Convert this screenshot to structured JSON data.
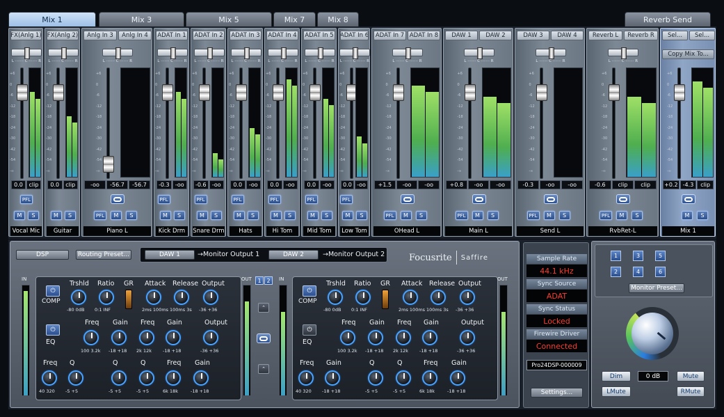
{
  "tabs": [
    "Mix 1",
    "Mix 3",
    "Mix 5",
    "Mix 7",
    "Mix 8",
    "Reverb Send"
  ],
  "active_tab": "Mix 1",
  "channel_headers": [
    "FX(Anlg 1)",
    "FX(Anlg 2)",
    "Anlg In 3",
    "Anlg In 4",
    "ADAT In 1",
    "ADAT In 2",
    "ADAT In 3",
    "ADAT In 4",
    "ADAT In 5",
    "ADAT In 6",
    "ADAT In 7",
    "ADAT In 8",
    "DAW 1",
    "DAW 2",
    "DAW 3",
    "DAW 4",
    "Reverb L",
    "Reverb R",
    "Sel...",
    "Sel..."
  ],
  "copy_mix_label": "Copy Mix To...",
  "pan_scale": "L ······· C ······· R",
  "fader_scale": [
    "+6",
    "0",
    "-6",
    "-12",
    "-18",
    "-24",
    "-30",
    "-42",
    "-54",
    "-∞"
  ],
  "channels": [
    {
      "name": "Vocal Mic",
      "readouts": [
        "0.0",
        "clip"
      ],
      "level": 0.78,
      "pfl": "PFL",
      "link": false
    },
    {
      "name": "Guitar",
      "readouts": [
        "0.0",
        "clip"
      ],
      "level": 0.56,
      "pfl": "PFL",
      "link": false
    },
    {
      "name": "Piano L",
      "readouts": [
        "-oo",
        "-56.7",
        "-56.7"
      ],
      "level": 0.0,
      "pfl": "PFL",
      "link": true
    },
    {
      "name": "Kick Drm",
      "readouts": [
        "-0.3",
        "-oo"
      ],
      "level": 0.78,
      "pfl": "PFL",
      "link": false
    },
    {
      "name": "Snare Drm",
      "readouts": [
        "-0.6",
        "-oo"
      ],
      "level": 0.22,
      "pfl": "PFL",
      "link": false
    },
    {
      "name": "Hats",
      "readouts": [
        "0.0",
        "-oo"
      ],
      "level": 0.45,
      "pfl": "PFL",
      "link": false
    },
    {
      "name": "Hi Tom",
      "readouts": [
        "0.0",
        "-oo"
      ],
      "level": 0.9,
      "pfl": "PFL",
      "link": false
    },
    {
      "name": "Mid Tom",
      "readouts": [
        "0.0",
        "-oo"
      ],
      "level": 0.72,
      "pfl": "PFL",
      "link": false
    },
    {
      "name": "Low Tom",
      "readouts": [
        "0.0",
        "-oo"
      ],
      "level": 0.37,
      "pfl": "PFL",
      "link": false
    },
    {
      "name": "OHead L",
      "readouts": [
        "+1.5",
        "-oo",
        "-oo"
      ],
      "level": 0.84,
      "pfl": "PFL",
      "link": true
    },
    {
      "name": "Main L",
      "readouts": [
        "+0.8",
        "-oo",
        "-oo"
      ],
      "level": 0.74,
      "pfl": "PFL",
      "link": true
    },
    {
      "name": "Send L",
      "readouts": [
        "-0.3",
        "-oo",
        "-oo"
      ],
      "level": 0.0,
      "pfl": "PFL",
      "link": true
    },
    {
      "name": "RvbRet-L",
      "readouts": [
        "-0.6",
        "clip",
        "clip"
      ],
      "level": 0.74,
      "pfl": "PFL",
      "link": true
    },
    {
      "name": "Mix 1",
      "readouts": [
        "+0.2",
        "-4.3",
        "clip"
      ],
      "level": 0.88,
      "pfl": "",
      "link": true
    }
  ],
  "mute_label": "M",
  "solo_label": "S",
  "dsp": {
    "dsp_label": "DSP",
    "routing_preset": "Routing Preset...",
    "route1_src": "DAW 1",
    "route1_dst": "→Monitor Output 1",
    "route2_src": "DAW 2",
    "route2_dst": "→Monitor Output 2",
    "logo_brand": "Focusrite",
    "logo_product": "Saffire",
    "in_label": "IN",
    "out_label": "OUT",
    "sel_1": "1",
    "sel_2": "2",
    "comp": {
      "label": "COMP",
      "params": [
        {
          "name": "Trshld",
          "range": "-80 0dB"
        },
        {
          "name": "Ratio",
          "range": "0:1 INF"
        },
        {
          "name": "GR",
          "range": ""
        },
        {
          "name": "Attack",
          "range": "2ms 100ms"
        },
        {
          "name": "Release",
          "range": "100ms 3s"
        },
        {
          "name": "Output",
          "range": "-36 +36"
        }
      ]
    },
    "eq": {
      "label": "EQ",
      "row1": [
        {
          "name": "Freq",
          "range": "100 3.2k"
        },
        {
          "name": "Gain",
          "range": "-18 +18"
        },
        {
          "name": "Freq",
          "range": "2k 12k"
        },
        {
          "name": "Gain",
          "range": "-18 +18"
        },
        {
          "name": "Output",
          "range": "-36 +36"
        }
      ],
      "row2": [
        {
          "name": "Freq",
          "range": "40 320"
        },
        {
          "name": "Q",
          "range": "-5 +5"
        },
        {
          "name": "Q",
          "range": "-5 +5"
        },
        {
          "name": "Q",
          "range": "-5 +5"
        },
        {
          "name": "Freq",
          "range": "6k 18k"
        },
        {
          "name": "Gain",
          "range": "-18 +18"
        }
      ]
    },
    "eq2": {
      "row1": [
        {
          "name": "Freq",
          "range": "100 3.2k"
        },
        {
          "name": "Gain",
          "range": "-18 +18"
        },
        {
          "name": "Freq",
          "range": "2k 12k"
        },
        {
          "name": "Gain",
          "range": "-18 +18"
        },
        {
          "name": "Output",
          "range": "-36 +36"
        }
      ],
      "row2": [
        {
          "name": "Freq",
          "range": "40 320"
        },
        {
          "name": "Gain",
          "range": "-18 +18"
        },
        {
          "name": "Q",
          "range": "-5 +5"
        },
        {
          "name": "Q",
          "range": "-5 +5"
        },
        {
          "name": "Freq",
          "range": "6k 18k"
        },
        {
          "name": "Gain",
          "range": "-18 +18"
        }
      ]
    }
  },
  "status": {
    "sample_rate_label": "Sample Rate",
    "sample_rate": "44.1 kHz",
    "sync_source_label": "Sync Source",
    "sync_source": "ADAT",
    "sync_status_label": "Sync Status",
    "sync_status": "Locked",
    "firewire_label": "Firewire Driver",
    "firewire": "Connected",
    "device": "Pro24DSP-000009",
    "settings": "Settings..."
  },
  "monitor": {
    "buttons": [
      "1",
      "2",
      "3",
      "4",
      "5",
      "6"
    ],
    "preset": "Monitor Preset...",
    "dim": "Dim",
    "level": "0 dB",
    "mute": "Mute",
    "lmute": "LMute",
    "rmute": "RMute"
  },
  "colors": {
    "accent": "#2b4f8c",
    "status_red": "#ff3a2e"
  }
}
